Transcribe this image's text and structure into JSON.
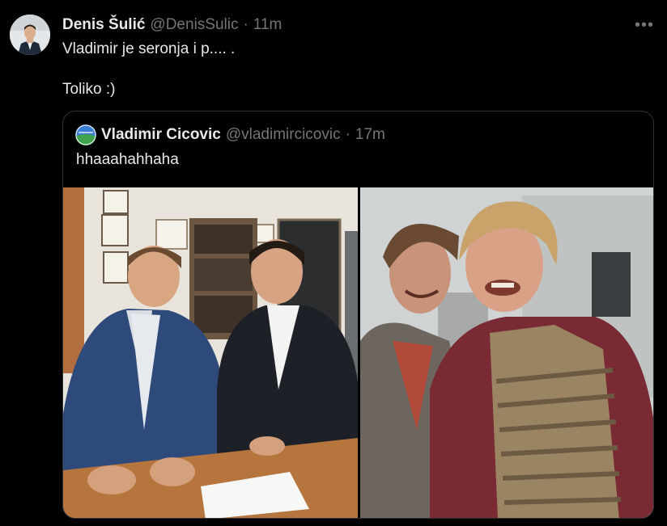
{
  "tweet": {
    "display_name": "Denis Šulić",
    "handle": "@DenisSulic",
    "separator": "·",
    "time": "11m",
    "more_label": "•••",
    "text_line1": "Vladimir je seronja i p.... .",
    "text_line2": "",
    "text_line3": "Toliko :)"
  },
  "quote": {
    "display_name": "Vladimir Cicovic",
    "handle": "@vladimircicovic",
    "separator": "·",
    "time": "17m",
    "text": "hhaaahahhaha"
  },
  "colors": {
    "background": "#000000",
    "text": "#e7e9ea",
    "muted": "#71767b",
    "border": "#2f3336"
  }
}
